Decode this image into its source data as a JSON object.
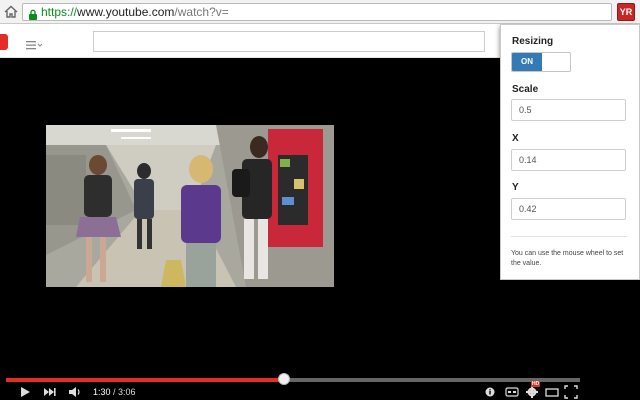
{
  "browser": {
    "url_scheme": "https://",
    "url_host": "www.youtube.com",
    "url_path": "/watch?v=",
    "extension_label": "YR"
  },
  "youtube": {
    "search_value": ""
  },
  "player": {
    "current_time": "1:30",
    "separator": " / ",
    "duration": "3:06",
    "progress_fraction": 0.484,
    "hd_label": "HD"
  },
  "popup": {
    "resizing_label": "Resizing",
    "toggle_on_label": "ON",
    "scale_label": "Scale",
    "scale_value": "0.5",
    "x_label": "X",
    "x_value": "0.14",
    "y_label": "Y",
    "y_value": "0.42",
    "hint": "You can use the mouse wheel to set the value."
  },
  "colors": {
    "accent_red": "#e52d27",
    "toggle_blue": "#337ab7",
    "url_green": "#0b8a1e"
  }
}
